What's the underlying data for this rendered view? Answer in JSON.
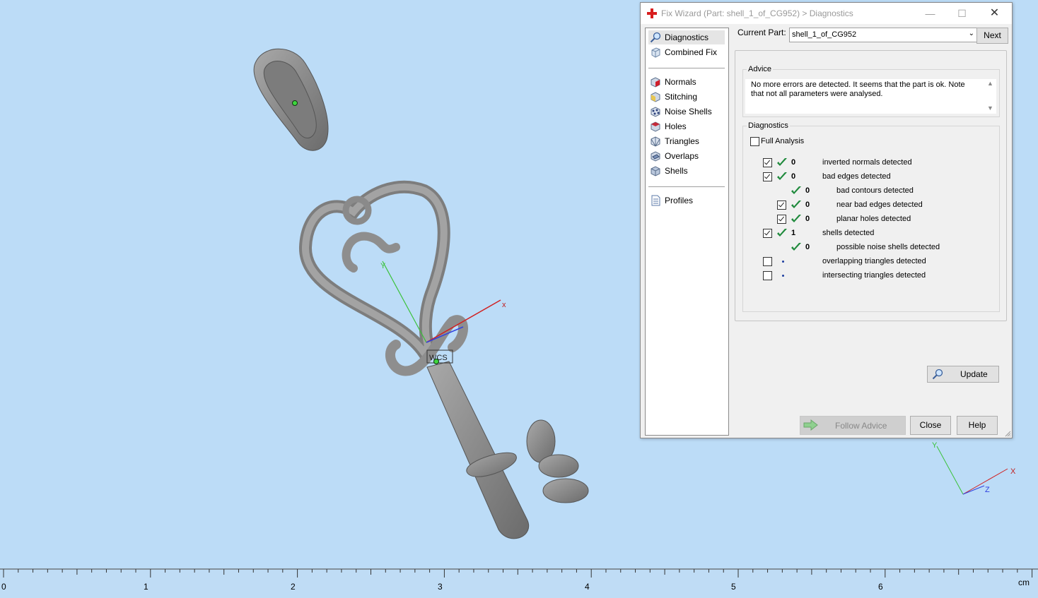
{
  "viewport": {
    "wcs_label": "WCS",
    "axis_x": "x",
    "axis_y": "Y",
    "corner_axis_x": "X",
    "corner_axis_y": "Y",
    "corner_axis_z": "Z"
  },
  "ruler": {
    "labels": [
      "0",
      "1",
      "2",
      "3",
      "4",
      "5",
      "6"
    ],
    "unit": "cm"
  },
  "dialog": {
    "title": "Fix Wizard (Part: shell_1_of_CG952) > Diagnostics",
    "nav": {
      "top": [
        {
          "label": "Diagnostics",
          "icon": "magnifier-icon",
          "selected": true
        },
        {
          "label": "Combined Fix",
          "icon": "combined-fix-icon"
        }
      ],
      "fixes": [
        {
          "label": "Normals",
          "icon": "normals-icon"
        },
        {
          "label": "Stitching",
          "icon": "stitching-icon"
        },
        {
          "label": "Noise Shells",
          "icon": "noise-shells-icon"
        },
        {
          "label": "Holes",
          "icon": "holes-icon"
        },
        {
          "label": "Triangles",
          "icon": "triangles-icon"
        },
        {
          "label": "Overlaps",
          "icon": "overlaps-icon"
        },
        {
          "label": "Shells",
          "icon": "shells-icon"
        }
      ],
      "bottom": [
        {
          "label": "Profiles",
          "icon": "profiles-icon"
        }
      ]
    },
    "current_part_label": "Current Part:",
    "current_part_value": "shell_1_of_CG952",
    "next_label": "Next",
    "advice_title": "Advice",
    "advice_text": "No more errors are detected. It seems that the part is ok. Note that not all parameters were analysed.",
    "diagnostics_title": "Diagnostics",
    "full_analysis_label": "Full Analysis",
    "rows": [
      {
        "checkbox": true,
        "checked": true,
        "status": "ok",
        "count": "0",
        "text": "inverted normals detected",
        "indent": 0
      },
      {
        "checkbox": true,
        "checked": true,
        "status": "ok",
        "count": "0",
        "text": "bad edges detected",
        "indent": 0
      },
      {
        "checkbox": false,
        "checked": false,
        "status": "ok",
        "count": "0",
        "text": "bad contours detected",
        "indent": 1
      },
      {
        "checkbox": true,
        "checked": true,
        "status": "ok",
        "count": "0",
        "text": "near bad edges detected",
        "indent": 1
      },
      {
        "checkbox": true,
        "checked": true,
        "status": "ok",
        "count": "0",
        "text": "planar holes detected",
        "indent": 1
      },
      {
        "checkbox": true,
        "checked": true,
        "status": "ok",
        "count": "1",
        "text": "shells detected",
        "indent": 0
      },
      {
        "checkbox": false,
        "checked": false,
        "status": "ok",
        "count": "0",
        "text": "possible noise shells detected",
        "indent": 1
      },
      {
        "checkbox": true,
        "checked": false,
        "status": "none",
        "count": "",
        "text": "overlapping triangles detected",
        "indent": 0
      },
      {
        "checkbox": true,
        "checked": false,
        "status": "none",
        "count": "",
        "text": "intersecting triangles detected",
        "indent": 0
      }
    ],
    "update_label": "Update",
    "follow_advice_label": "Follow Advice",
    "close_label": "Close",
    "help_label": "Help",
    "colors": {
      "ok_tick": "#1f8a3c",
      "title_icon": "#d81e1e"
    }
  }
}
